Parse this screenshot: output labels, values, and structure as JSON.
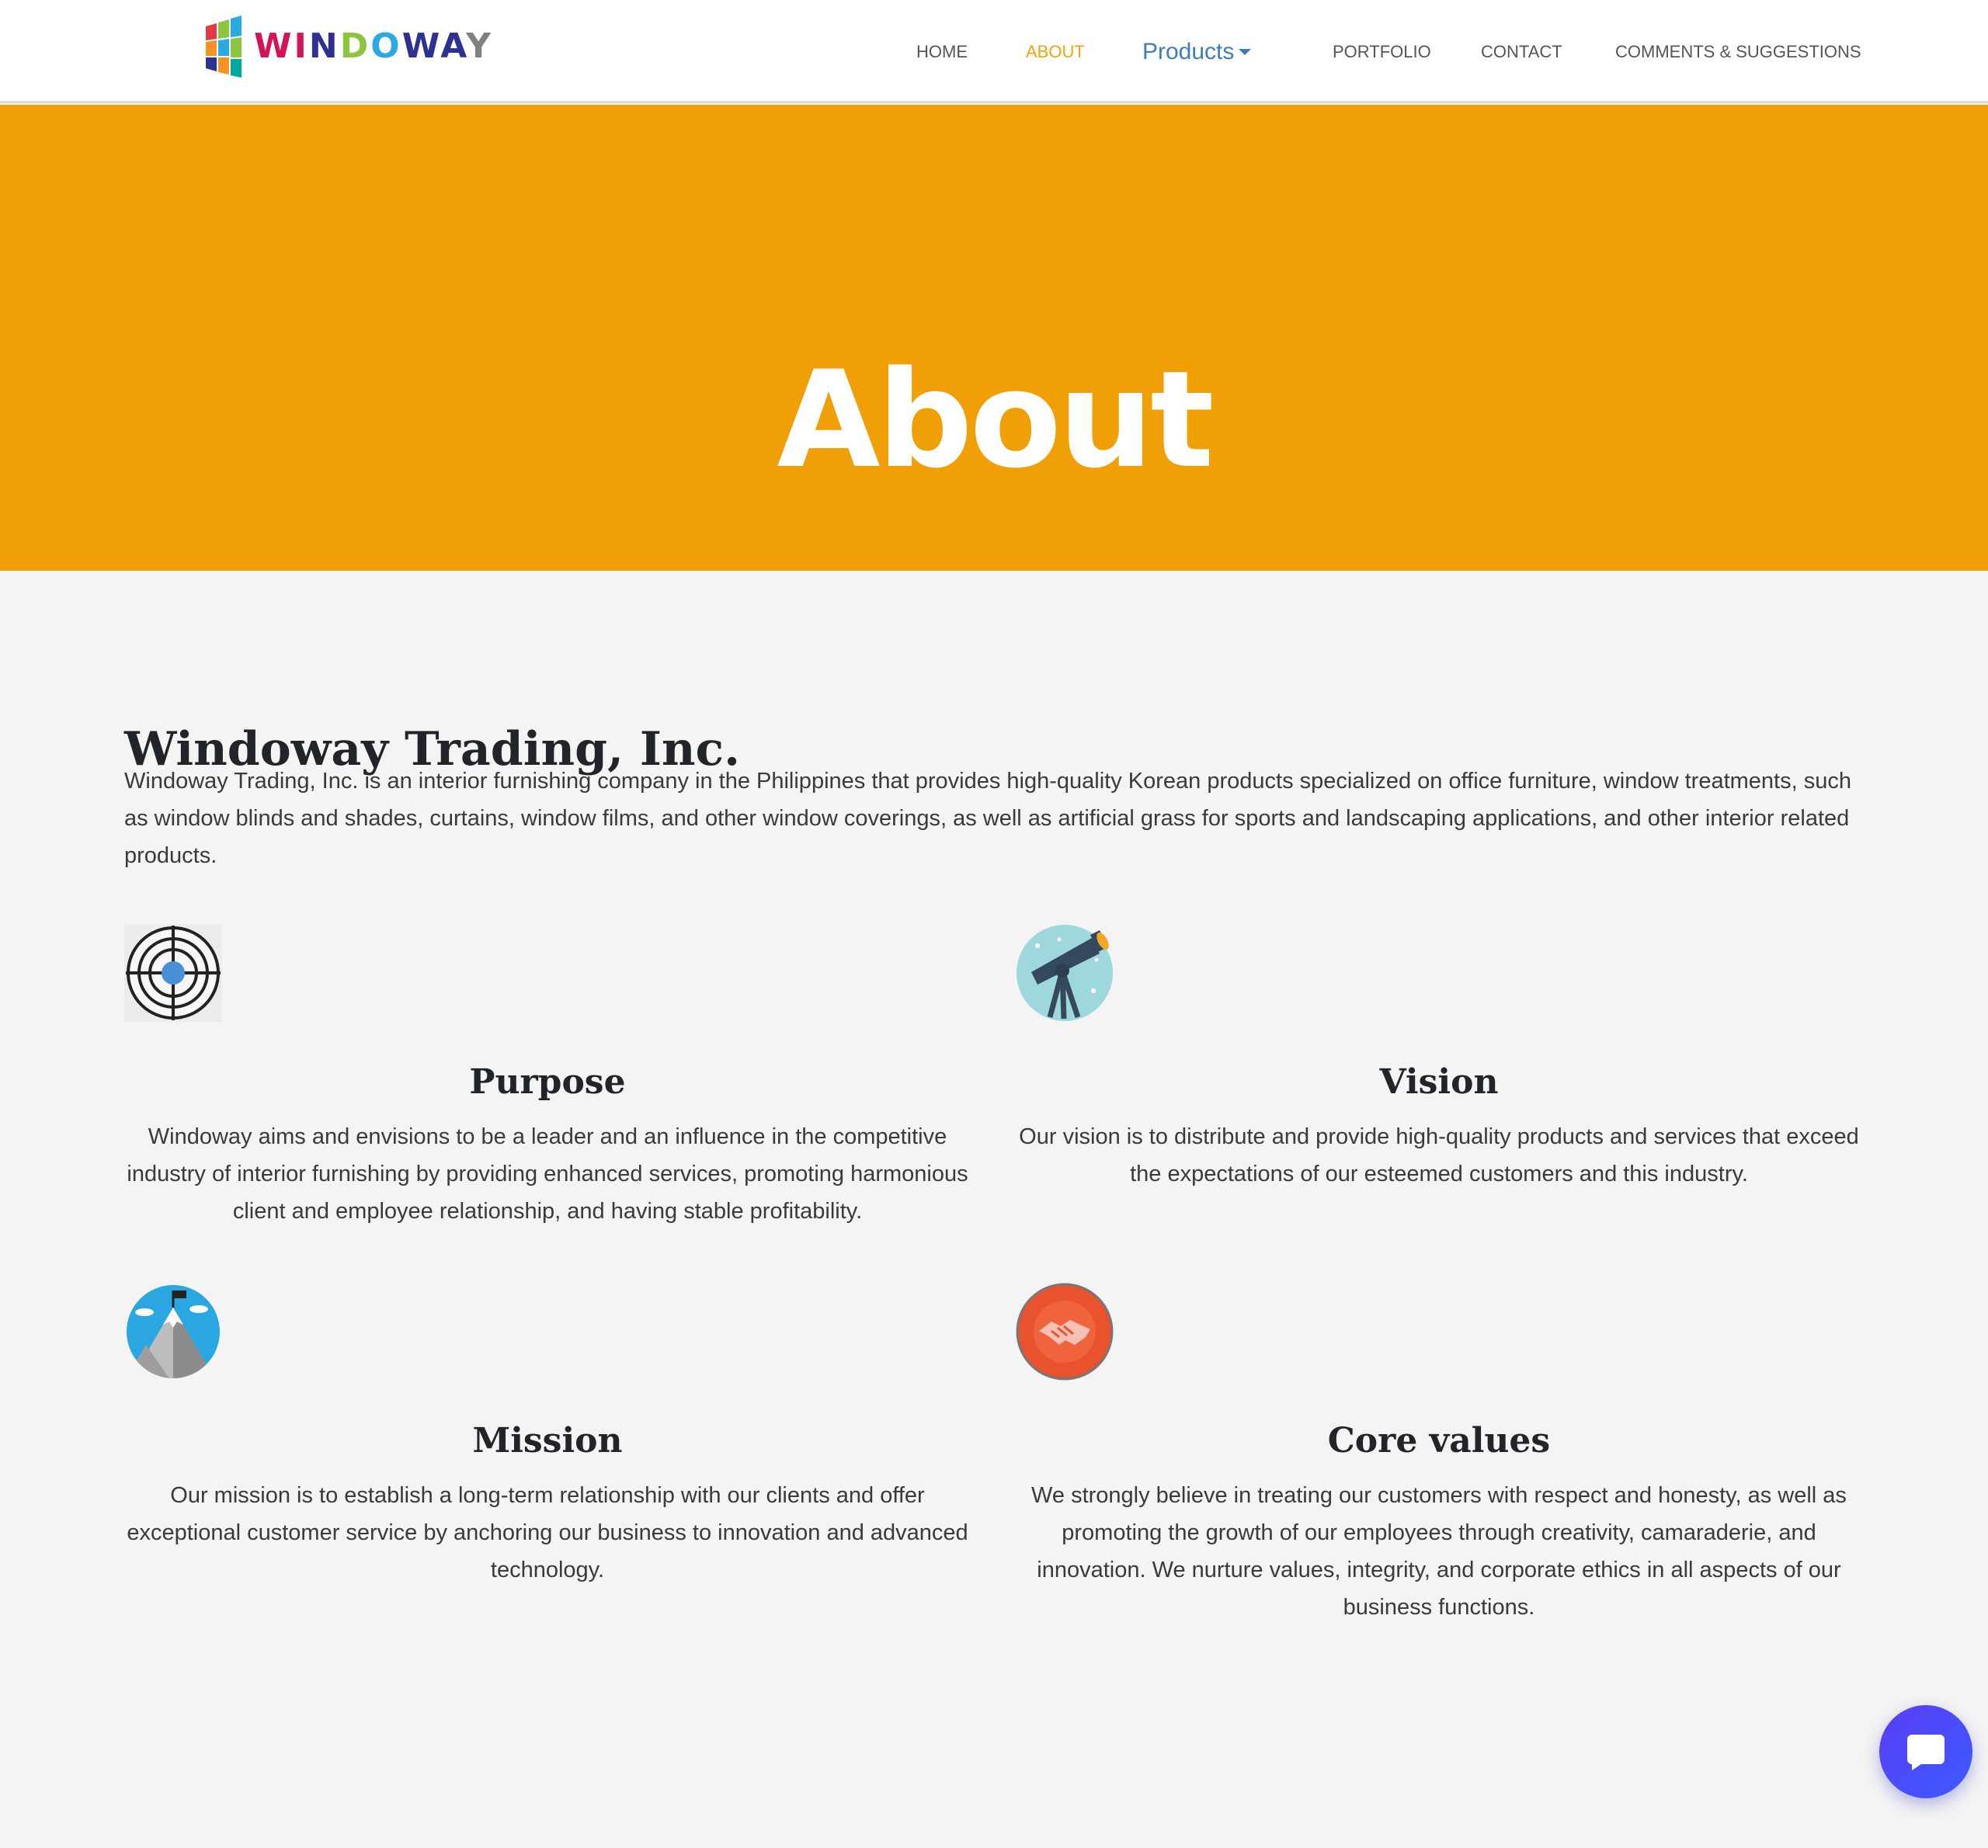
{
  "brand": {
    "name": "WINDOWAY",
    "letters": [
      {
        "ch": "W",
        "color": "#d4145a"
      },
      {
        "ch": "I",
        "color": "#d4145a"
      },
      {
        "ch": "N",
        "color": "#2e3192"
      },
      {
        "ch": "D",
        "color": "#8cc63f"
      },
      {
        "ch": "O",
        "color": "#29abe2"
      },
      {
        "ch": "W",
        "color": "#2e3192"
      },
      {
        "ch": "A",
        "color": "#2e3192"
      },
      {
        "ch": "Y",
        "color": "#808080"
      }
    ]
  },
  "nav": {
    "home": "HOME",
    "about": "ABOUT",
    "products": "Products",
    "portfolio": "PORTFOLIO",
    "contact": "CONTACT",
    "comments": "COMMENTS & SUGGESTIONS",
    "active": "about"
  },
  "hero": {
    "title": "About",
    "background": "#f0a006"
  },
  "company": {
    "title": "Windoway Trading, Inc.",
    "description": "Windoway Trading, Inc. is an interior furnishing company in the Philippines that provides high-quality Korean products specialized on office furniture, window treatments, such as window blinds and shades, curtains, window films, and other window coverings, as well as artificial grass for sports and landscaping applications, and other interior related products."
  },
  "cards": {
    "purpose": {
      "icon": "target-icon",
      "title": "Purpose",
      "text": "Windoway aims and envisions to be a leader and an influence in the competitive industry of interior furnishing by providing enhanced services, promoting harmonious client and employee relationship, and having stable profitability."
    },
    "vision": {
      "icon": "telescope-icon",
      "title": "Vision",
      "text": "Our vision is to distribute and provide high-quality products and services that exceed the expectations of our esteemed customers and this industry."
    },
    "mission": {
      "icon": "mountain-flag-icon",
      "title": "Mission",
      "text": "Our mission is to establish a long-term relationship with our clients and offer exceptional customer service by anchoring our business to innovation and advanced technology."
    },
    "core_values": {
      "icon": "handshake-icon",
      "title": "Core values",
      "text": "We strongly believe in treating our customers with respect and honesty, as well as promoting the growth of our employees through creativity, camaraderie, and innovation. We nurture values, integrity, and corporate ethics in all aspects of our business functions."
    }
  },
  "chat": {
    "icon": "chat-bubble-icon"
  }
}
